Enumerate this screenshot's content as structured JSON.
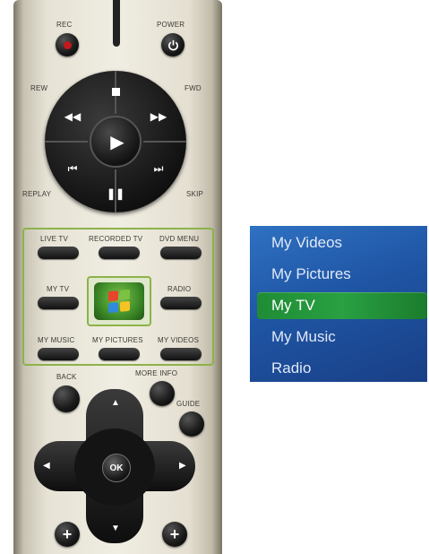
{
  "remote": {
    "labels": {
      "rec": "REC",
      "power": "POWER",
      "rew": "REW",
      "fwd": "FWD",
      "replay": "REPLAY",
      "skip": "SKIP",
      "live_tv": "LIVE TV",
      "recorded_tv": "RECORDED TV",
      "dvd_menu": "DVD MENU",
      "my_tv": "MY TV",
      "radio": "RADIO",
      "my_music": "MY MUSIC",
      "my_pictures": "MY PICTURES",
      "my_videos": "MY VIDEOS",
      "back": "BACK",
      "more_info": "MORE INFO",
      "guide": "GUIDE",
      "ok": "OK"
    },
    "icons": {
      "power": "power-icon",
      "stop": "stop-icon",
      "rewind": "rewind-icon",
      "fast_forward": "fast-forward-icon",
      "play": "play-icon",
      "replay": "skip-back-icon",
      "skip": "skip-forward-icon",
      "pause": "pause-icon",
      "start": "windows-start-icon"
    },
    "accent_color": "#8cb34a",
    "rec_color": "#c3181b"
  },
  "menu": {
    "items": [
      {
        "label": "My Videos",
        "selected": false
      },
      {
        "label": "My Pictures",
        "selected": false
      },
      {
        "label": "My TV",
        "selected": true
      },
      {
        "label": "My Music",
        "selected": false
      },
      {
        "label": "Radio",
        "selected": false
      }
    ],
    "background_color": "#1f55a4",
    "selection_color": "#29a042"
  }
}
